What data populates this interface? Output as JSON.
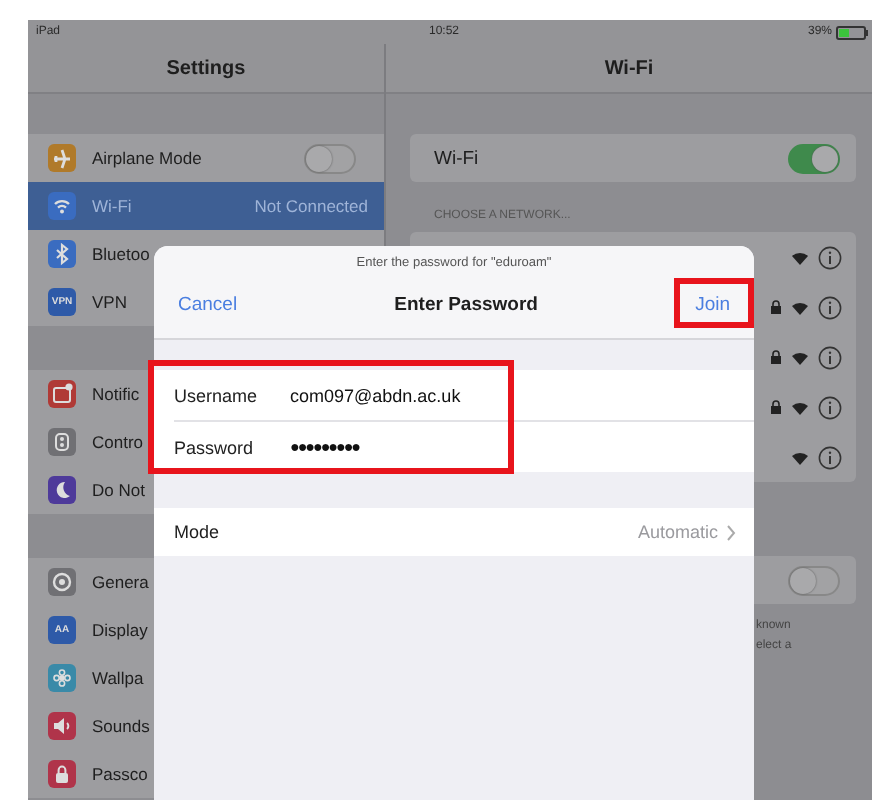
{
  "status_bar": {
    "device": "iPad",
    "time": "10:52",
    "battery": "39%"
  },
  "sidebar": {
    "title": "Settings",
    "groups": [
      {
        "items": [
          {
            "label": "Airplane Mode",
            "kind": "toggle",
            "on": false,
            "selected": false,
            "color": "#b07a2a"
          },
          {
            "label": "Wi-Fi",
            "kind": "value",
            "value": "Not Connected",
            "selected": true,
            "color": "#3a6cc0"
          },
          {
            "label": "Bluetoo",
            "kind": "plain",
            "selected": false,
            "color": "#3a6cc0"
          },
          {
            "label": "VPN",
            "kind": "plain",
            "icon_text": "VPN",
            "selected": false,
            "color": "#2e5aa8"
          }
        ]
      },
      {
        "items": [
          {
            "label": "Notific",
            "kind": "plain",
            "selected": false,
            "color": "#b03a36"
          },
          {
            "label": "Contro",
            "kind": "plain",
            "selected": false,
            "color": "#707074"
          },
          {
            "label": "Do Not",
            "kind": "plain",
            "selected": false,
            "color": "#4e3a9a"
          }
        ]
      },
      {
        "items": [
          {
            "label": "Genera",
            "kind": "plain",
            "selected": false,
            "color": "#707074"
          },
          {
            "label": "Display",
            "kind": "plain",
            "icon_text": "AA",
            "selected": false,
            "color": "#2e5aa8"
          },
          {
            "label": "Wallpa",
            "kind": "plain",
            "selected": false,
            "color": "#3a8aa8"
          },
          {
            "label": "Sounds",
            "kind": "plain",
            "selected": false,
            "color": "#b0344a"
          },
          {
            "label": "Passco",
            "kind": "plain",
            "selected": false,
            "color": "#b0344a"
          }
        ]
      }
    ]
  },
  "detail": {
    "title": "Wi-Fi",
    "wifi_row": {
      "label": "Wi-Fi",
      "on": true
    },
    "section_header": "CHOOSE A NETWORK...",
    "networks": [
      {
        "locked": false
      },
      {
        "locked": true
      },
      {
        "locked": true
      },
      {
        "locked": true
      },
      {
        "locked": false
      }
    ],
    "ask_row": {
      "on": false
    },
    "footer_lines": [
      "known",
      "elect a"
    ]
  },
  "dialog": {
    "prompt": "Enter the password for \"eduroam\"",
    "title": "Enter Password",
    "cancel": "Cancel",
    "join": "Join",
    "fields": [
      {
        "label": "Username",
        "value": "com097@abdn.ac.uk",
        "kind": "text"
      },
      {
        "label": "Password",
        "value": "●●●●●●●●●",
        "kind": "secure"
      }
    ],
    "mode": {
      "label": "Mode",
      "value": "Automatic"
    },
    "join_highlighted": true,
    "fields_highlighted": true
  }
}
